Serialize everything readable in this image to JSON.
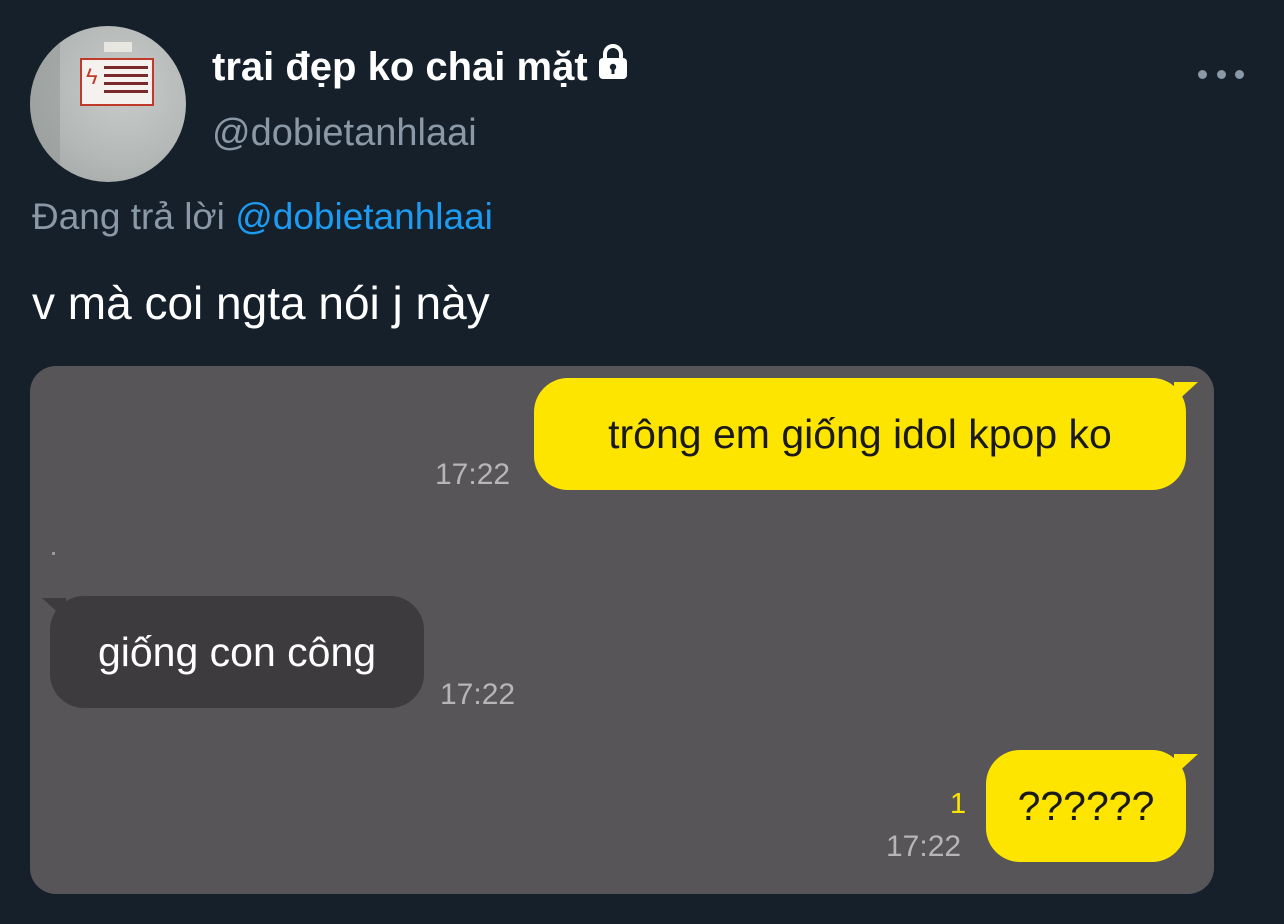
{
  "profile": {
    "display_name": "trai đẹp ko chai mặt",
    "handle": "@dobietanhlaai",
    "protected_icon": "lock-icon",
    "more_icon": "more-horizontal-icon"
  },
  "reply": {
    "prefix": "Đang trả lời ",
    "mention": "@dobietanhlaai"
  },
  "tweet": {
    "text": "v mà coi ngta nói j này"
  },
  "chat": {
    "messages": [
      {
        "sender": "me",
        "text": "trông em giống idol kpop ko",
        "time": "17:22"
      },
      {
        "sender": "other",
        "text": "giống con công",
        "time": "17:22"
      },
      {
        "sender": "me",
        "text": "??????",
        "time": "17:22",
        "unread": "1"
      }
    ]
  },
  "colors": {
    "background": "#15202b",
    "secondary_text": "#8b98a5",
    "mention": "#1d9bf0",
    "my_bubble": "#fee500",
    "other_bubble": "#3d3b3d",
    "chat_background": "#575557"
  }
}
